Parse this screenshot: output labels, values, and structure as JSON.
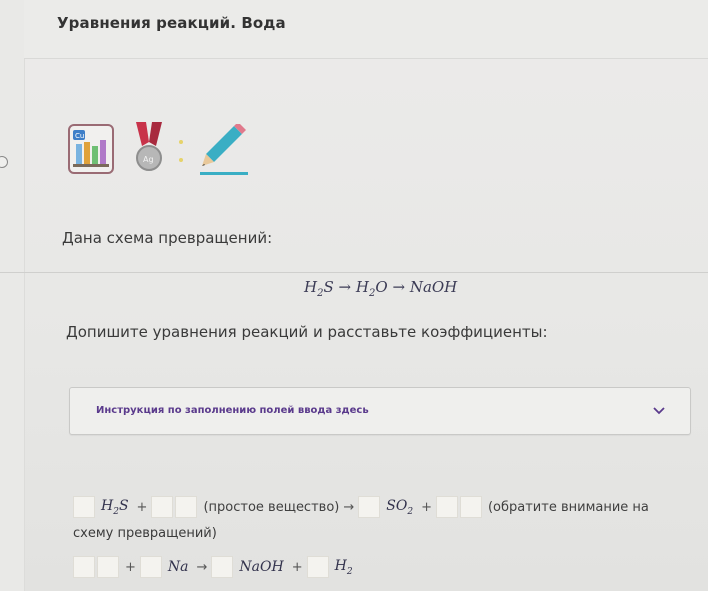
{
  "header": {
    "title": "Уравнения реакций. Вода"
  },
  "task": {
    "given_label": "Дана схема превращений:",
    "scheme": {
      "s1": "H",
      "s1_sub": "2",
      "s1_tail": "S",
      "arrow": "→",
      "s2": "H",
      "s2_sub": "2",
      "s2_tail": "O",
      "s3": "NaOH"
    },
    "complete_label": "Допишите уравнения реакций и расставьте коэффициенты:",
    "instruction": "Инструкция по заполнению полей ввода здесь"
  },
  "equation1": {
    "h2s": "H",
    "h2s_sub": "2",
    "h2s_tail": "S",
    "plus": "+",
    "simple": "(простое вещество)",
    "arrow": "→",
    "so2": "SO",
    "so2_sub": "2",
    "plus2": "+",
    "note_a": "(обратите внимание на",
    "note_b": "схему превращений)"
  },
  "equation2": {
    "plus": "+",
    "na": "Na",
    "arrow": "→",
    "naoh": "NaOH",
    "plus2": "+",
    "h2": "H",
    "h2_sub": "2"
  },
  "icons": [
    "lab-flasks-icon",
    "medal-icon",
    "sparkle-icon",
    "pencil-icon"
  ],
  "colors": {
    "accent": "#5a3a8c",
    "lab_border": "#9a6b74",
    "medal_ribbon": "#c8334a",
    "pencil": "#3aaec4"
  }
}
